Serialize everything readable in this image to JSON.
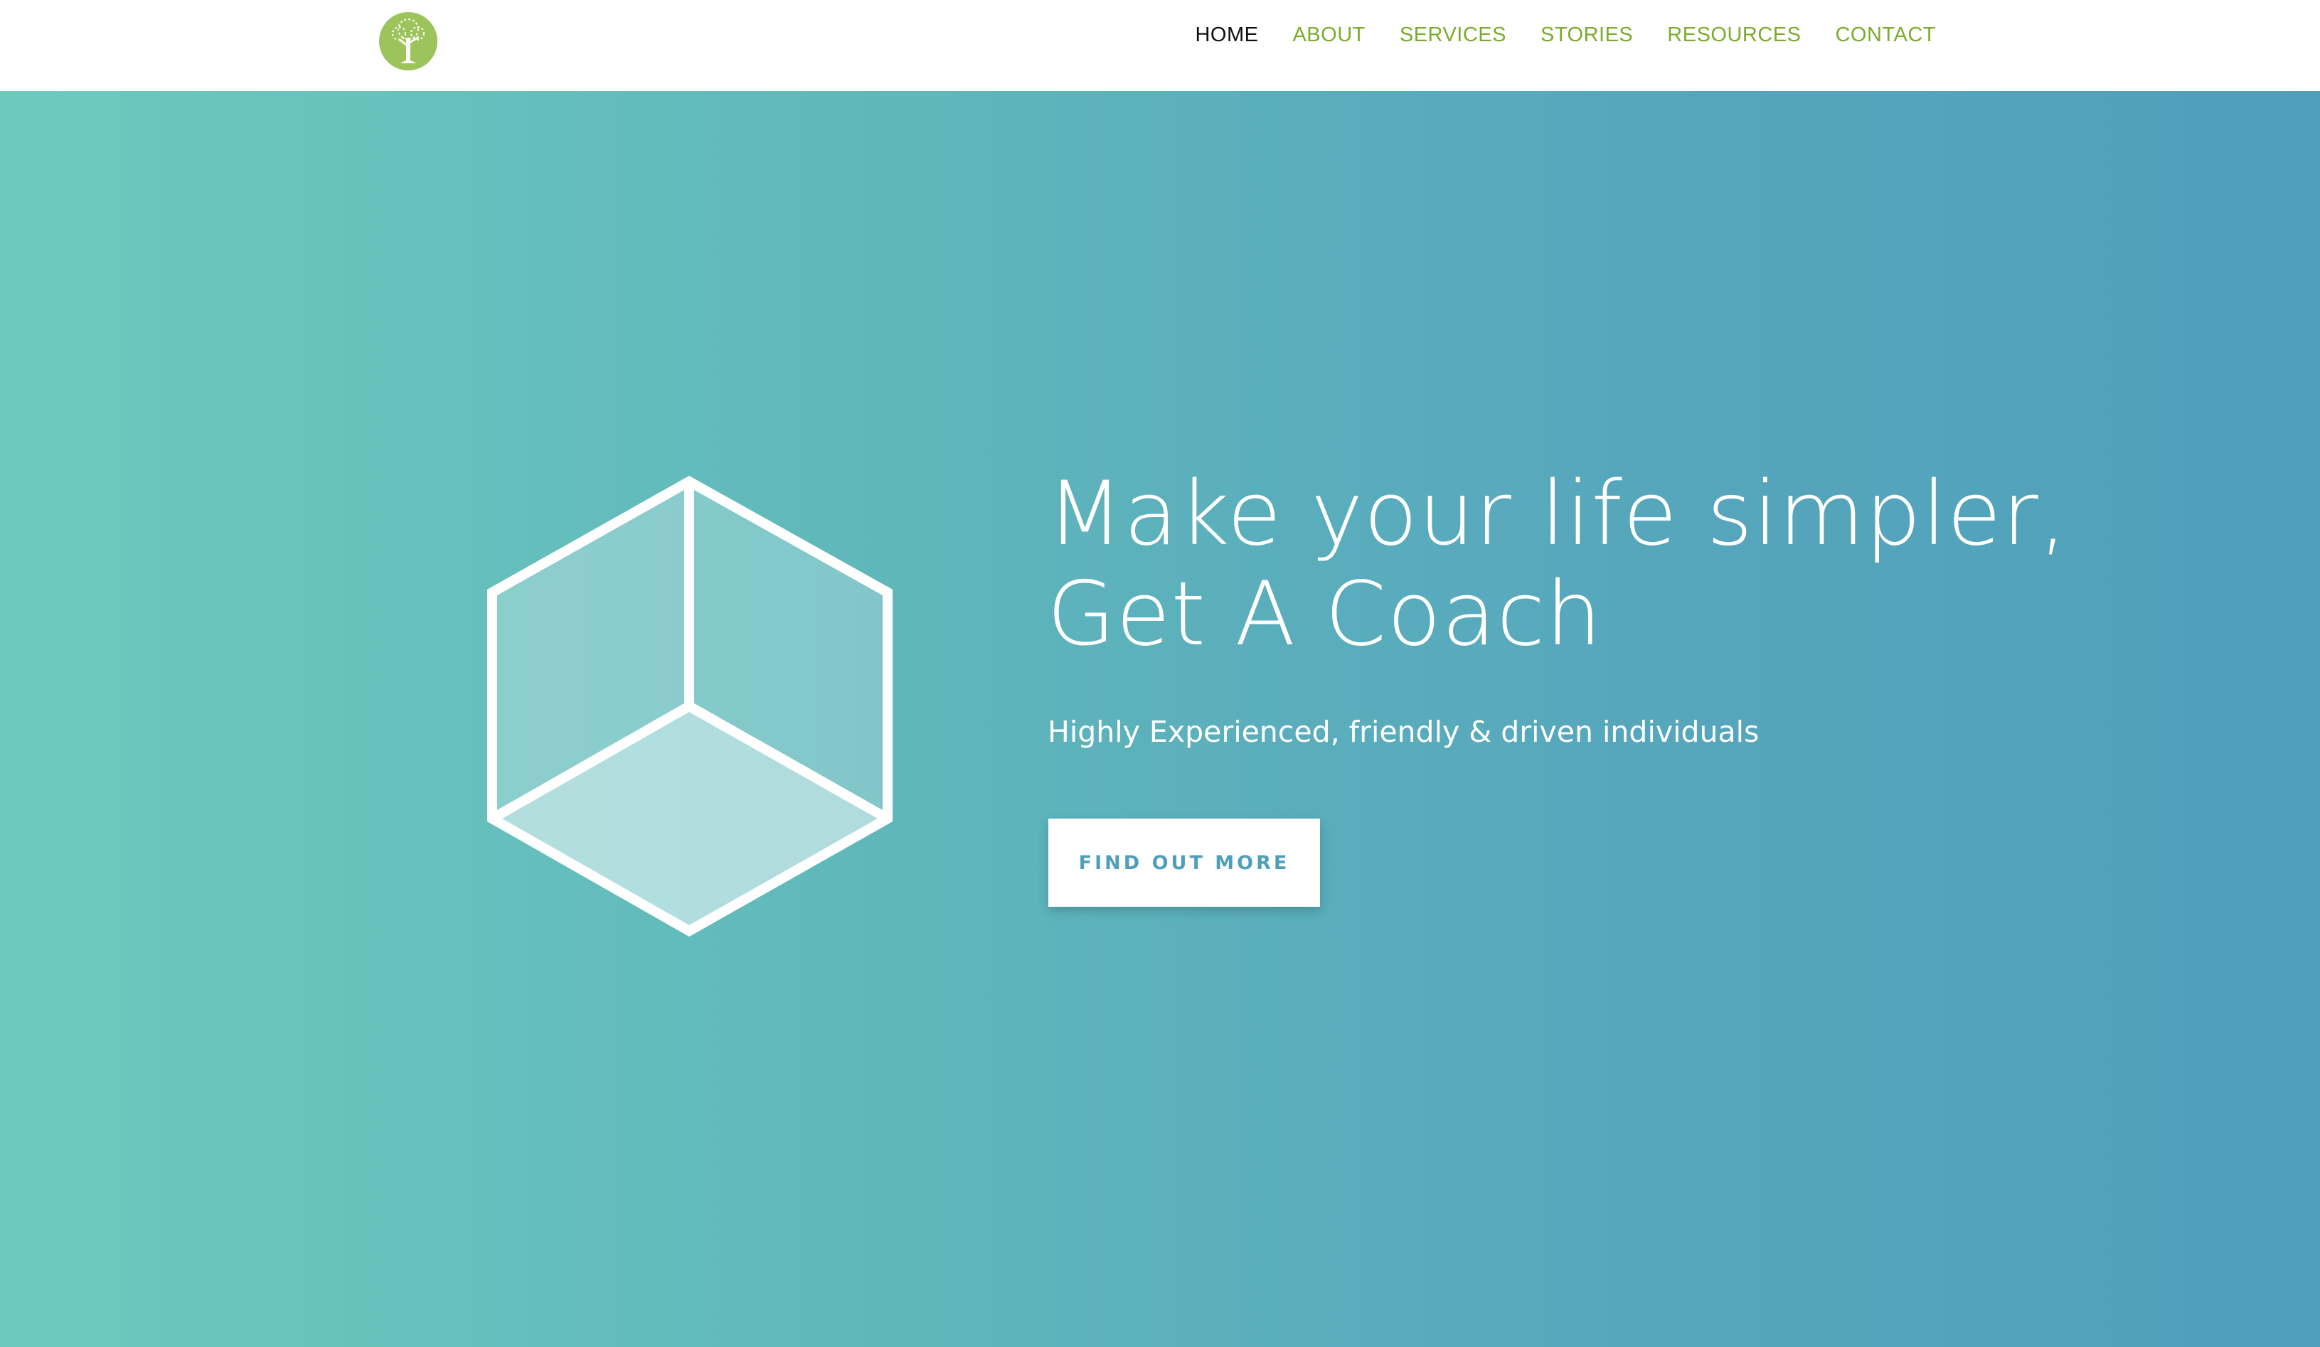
{
  "header": {
    "logo_icon": "tree-logo-icon",
    "nav": [
      {
        "label": "HOME",
        "active": true
      },
      {
        "label": "ABOUT"
      },
      {
        "label": "SERVICES"
      },
      {
        "label": "STORIES"
      },
      {
        "label": "RESOURCES"
      },
      {
        "label": "CONTACT"
      }
    ]
  },
  "hero": {
    "cube_icon": "cube-icon",
    "headline_line1": "Make your life simpler,",
    "headline_line2": "Get A Coach",
    "subheadline": "Highly Experienced, friendly & driven individuals",
    "cta_label": "FIND OUT MORE"
  },
  "colors": {
    "nav_text": "#7dab2b",
    "nav_active": "#111111",
    "gradient_start": "#6ccabd",
    "gradient_end": "#4f9fbb",
    "cta_text": "#4f9fbb",
    "logo_green": "#9cc45a"
  }
}
